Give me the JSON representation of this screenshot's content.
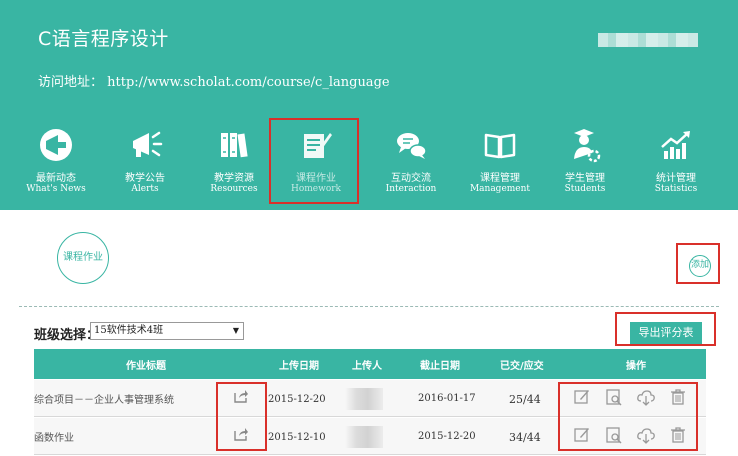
{
  "header": {
    "course_title": "C语言程序设计",
    "access_url": "访问地址： http://www.scholat.com/course/c_language"
  },
  "nav": {
    "items": [
      {
        "zh": "最新动态",
        "en": "What's News",
        "icon": "megaphone-circle-icon"
      },
      {
        "zh": "教学公告",
        "en": "Alerts",
        "icon": "megaphone-icon"
      },
      {
        "zh": "教学资源",
        "en": "Resources",
        "icon": "books-icon"
      },
      {
        "zh": "课程作业",
        "en": "Homework",
        "icon": "homework-pencil-icon"
      },
      {
        "zh": "互动交流",
        "en": "Interaction",
        "icon": "chat-bubbles-icon"
      },
      {
        "zh": "课程管理",
        "en": "Management",
        "icon": "open-book-icon"
      },
      {
        "zh": "学生管理",
        "en": "Students",
        "icon": "student-gear-icon"
      },
      {
        "zh": "统计管理",
        "en": "Statistics",
        "icon": "chart-up-icon"
      }
    ]
  },
  "section": {
    "circle_label": "课程作业",
    "add_label": "添加"
  },
  "filter": {
    "label": "班级选择：",
    "selected": "15软件技术4班"
  },
  "export_label": "导出评分表",
  "table": {
    "headers": {
      "title": "作业标题",
      "upload_date": "上传日期",
      "uploader": "上传人",
      "deadline": "截止日期",
      "submitted": "已交/应交",
      "actions": "操作"
    },
    "rows": [
      {
        "title": "综合项目－－企业人事管理系统",
        "upload_date": "2015-12-20",
        "deadline": "2016-01-17",
        "submitted": "25/44"
      },
      {
        "title": "函数作业",
        "upload_date": "2015-12-10",
        "deadline": "2015-12-20",
        "submitted": "34/44"
      }
    ]
  },
  "colors": {
    "brand": "#39b5a3",
    "highlight_border": "#d9302a"
  }
}
